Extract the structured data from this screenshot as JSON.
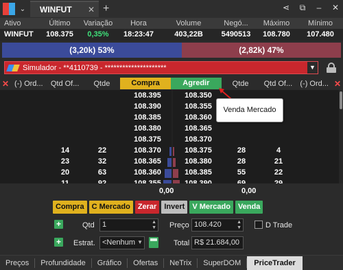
{
  "titlebar": {
    "tab_label": "WINFUT",
    "icons": [
      "share-icon",
      "popout-icon",
      "minimize-icon",
      "close-icon"
    ]
  },
  "quote": {
    "headers": [
      "Ativo",
      "Último",
      "Variação",
      "Hora",
      "Volume",
      "Negó...",
      "Máximo",
      "Mínimo"
    ],
    "values": [
      "WINFUT",
      "108.375",
      "0,35%",
      "18:23:47",
      "403,22B",
      "5490513",
      "108.780",
      "107.480"
    ]
  },
  "strength": {
    "buy_label": "(3,20k) 53%",
    "sell_label": "(2,82k) 47%",
    "buy_pct": 53
  },
  "account": {
    "label": "Simulador - **4110739 - *********************"
  },
  "book_headers": {
    "ord_left": "(-) Ord...",
    "qtd_of_left": "Qtd Of...",
    "qtde_left": "Qtde",
    "compra": "Compra",
    "agredir": "Agredir",
    "qtde_right": "Qtde",
    "qtd_of_right": "Qtd Of...",
    "ord_right": "(-) Ord..."
  },
  "book": {
    "rows": [
      {
        "qtd_of_l": "",
        "qtde_l": "",
        "bid": "108.395",
        "ask": "108.350",
        "qtde_r": "",
        "qtd_of_r": ""
      },
      {
        "qtd_of_l": "",
        "qtde_l": "",
        "bid": "108.390",
        "ask": "108.355",
        "qtde_r": "",
        "qtd_of_r": ""
      },
      {
        "qtd_of_l": "",
        "qtde_l": "",
        "bid": "108.385",
        "ask": "108.360",
        "qtde_r": "",
        "qtd_of_r": ""
      },
      {
        "qtd_of_l": "",
        "qtde_l": "",
        "bid": "108.380",
        "ask": "108.365",
        "qtde_r": "",
        "qtd_of_r": ""
      },
      {
        "qtd_of_l": "",
        "qtde_l": "",
        "bid": "108.375",
        "ask": "108.370",
        "qtde_r": "",
        "qtd_of_r": ""
      },
      {
        "qtd_of_l": "14",
        "qtde_l": "22",
        "bid": "108.370",
        "ask": "108.375",
        "qtde_r": "28",
        "qtd_of_r": "4"
      },
      {
        "qtd_of_l": "23",
        "qtde_l": "32",
        "bid": "108.365",
        "ask": "108.380",
        "qtde_r": "28",
        "qtd_of_r": "21"
      },
      {
        "qtd_of_l": "20",
        "qtde_l": "63",
        "bid": "108.360",
        "ask": "108.385",
        "qtde_r": "55",
        "qtd_of_r": "22"
      },
      {
        "qtd_of_l": "11",
        "qtde_l": "92",
        "bid": "108.355",
        "ask": "108.390",
        "qtde_r": "69",
        "qtd_of_r": "29"
      }
    ]
  },
  "tooltip": {
    "text": "Venda Mercado"
  },
  "totals": {
    "left": "0,00",
    "right": "0,00"
  },
  "actions": {
    "compra": "Compra",
    "c_mercado": "C Mercado",
    "zerar": "Zerar",
    "invert": "Invert",
    "v_mercado": "V Mercado",
    "venda": "Venda"
  },
  "form": {
    "qtd_label": "Qtd",
    "qtd_value": "1",
    "preco_label": "Preço",
    "preco_value": "108.420",
    "dtrade_label": "D Trade",
    "estrat_label": "Estrat.",
    "estrat_value": "<Nenhum",
    "total_label": "Total",
    "total_value": "R$ 21.684,00"
  },
  "bottom_tabs": [
    "Preços",
    "Profundidade",
    "Gráfico",
    "Ofertas",
    "NeTrix",
    "SuperDOM",
    "PriceTrader"
  ],
  "colors": {
    "buy_bar": "#3b4b9a",
    "sell_bar": "#8e3e4c",
    "compra": "#e0b11e",
    "agredir": "#3aa85d",
    "zerar": "#c9272d",
    "accent_green": "#3fe07a"
  }
}
